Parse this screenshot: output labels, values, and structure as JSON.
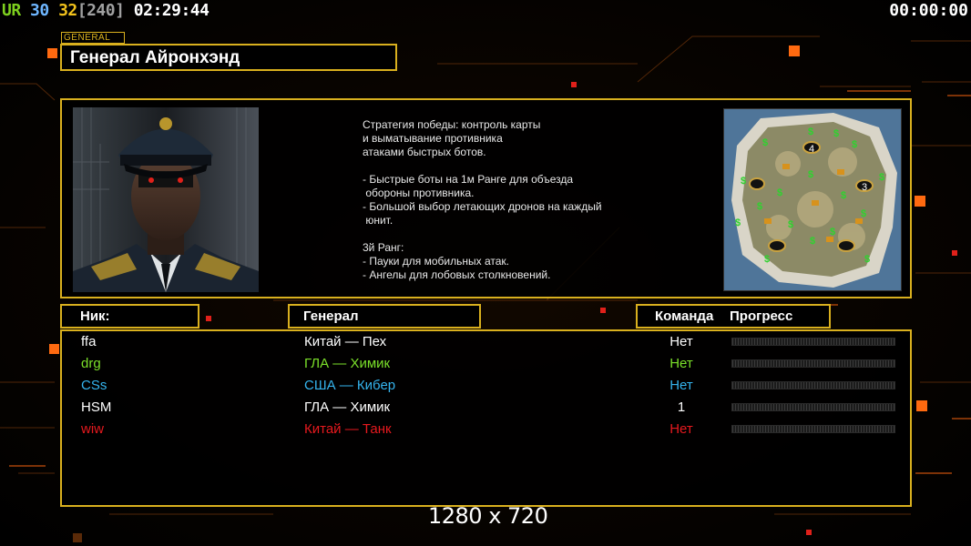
{
  "hud": {
    "mode": "UR",
    "val1": "30",
    "val2": "32",
    "bracket": "[240]",
    "clock": "02:29:44",
    "timer": "00:00:00",
    "colors": {
      "mode": "#7dcf1e",
      "val1": "#6eb6ff",
      "val2": "#f2c21c",
      "bracket": "#a0a0a0"
    }
  },
  "general": {
    "tag": "GENERAL",
    "name": "Генерал Айронхэнд",
    "portrait_icon": "general-portrait",
    "description": [
      "Стратегия победы: контроль карты",
      "и выматывание противника",
      "атаками быстрых ботов.",
      "",
      "- Быстрые боты на 1м Ранге для объезда",
      " обороны противника.",
      "- Большой выбор летающих дронов на каждый",
      " юнит.",
      "",
      "3й Ранг:",
      "- Пауки для мобильных атак.",
      "- Ангелы для лобовых столкновений."
    ],
    "minimap_icon": "map-preview",
    "minimap_slots": [
      "4",
      "3"
    ]
  },
  "columns": {
    "nick": "Ник:",
    "general": "Генерал",
    "team": "Команда",
    "progress": "Прогресс"
  },
  "players": [
    {
      "nick": "ffa",
      "general": "Китай — Пех",
      "team": "Нет",
      "color": "#ffffff",
      "progress": 0
    },
    {
      "nick": "drg",
      "general": "ГЛА — Химик",
      "team": "Нет",
      "color": "#7be02a",
      "progress": 0
    },
    {
      "nick": "CSs",
      "general": "США — Кибер",
      "team": "Нет",
      "color": "#35b4ee",
      "progress": 0
    },
    {
      "nick": "HSM",
      "general": "ГЛА — Химик",
      "team": "1",
      "color": "#ffffff",
      "progress": 0
    },
    {
      "nick": "wiw",
      "general": "Китай — Танк",
      "team": "Нет",
      "color": "#e6191e",
      "progress": 0
    }
  ],
  "resolution": "1280 x 720",
  "theme": {
    "accent": "#d9b01e",
    "glow": "#ff6a10"
  }
}
